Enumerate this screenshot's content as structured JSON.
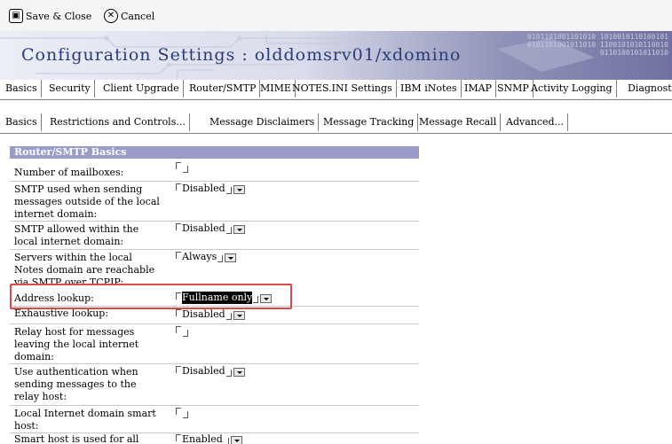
{
  "toolbar": {
    "save_label": "Save & Close",
    "cancel_label": "Cancel"
  },
  "banner": {
    "title": "Configuration Settings : olddomsrv01/xdomino",
    "binary_text": "0101101001101010 1010010110100101 0101101001011010 1100101010110010 0110100101011010"
  },
  "top_tabs": [
    {
      "label": "Basics"
    },
    {
      "label": "Security"
    },
    {
      "label": "Client Upgrade"
    },
    {
      "label": "Router/SMTP",
      "active": true
    },
    {
      "label": "MIME"
    },
    {
      "label": "NOTES.INI Settings"
    },
    {
      "label": "IBM iNotes"
    },
    {
      "label": "IMAP"
    },
    {
      "label": "SNMP"
    },
    {
      "label": "Activity Logging"
    },
    {
      "label": "Diagnost"
    }
  ],
  "sub_tabs": [
    {
      "label": "Basics",
      "active": true
    },
    {
      "label": "Restrictions and Controls..."
    },
    {
      "label": "Message Disclaimers"
    },
    {
      "label": "Message Tracking"
    },
    {
      "label": "Message Recall"
    },
    {
      "label": "Advanced..."
    }
  ],
  "section": {
    "header": "Router/SMTP Basics",
    "rows": [
      {
        "label": "Number of mailboxes:",
        "value": ""
      },
      {
        "label": "SMTP used when sending messages outside of the local internet domain:",
        "value": "Disabled"
      },
      {
        "label": "SMTP allowed within the local internet domain:",
        "value": "Disabled"
      },
      {
        "label": "Servers within the local Notes domain are reachable via SMTP over TCPIP:",
        "value": "Always"
      },
      {
        "label": "Address lookup:",
        "value": "Fullname only"
      },
      {
        "label": "Exhaustive lookup:",
        "value": "Disabled"
      },
      {
        "label": "Relay host for messages leaving the local internet domain:",
        "value": ""
      },
      {
        "label": "Use authentication when sending messages to the relay host:",
        "value": "Disabled"
      },
      {
        "label": "Local Internet domain smart host:",
        "value": ""
      },
      {
        "label": "Smart host is used for all",
        "value": "Enabled"
      }
    ]
  },
  "colors": {
    "section_header_bg": "#9a9cc8",
    "highlight_border": "#e04848",
    "title_color": "#2a3b7a"
  }
}
